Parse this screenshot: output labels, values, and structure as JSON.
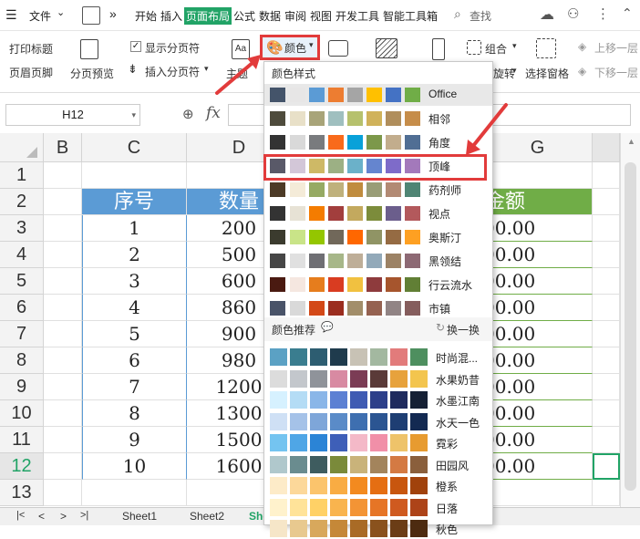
{
  "menubar": {
    "file_label": "文件",
    "more_label": "»",
    "tabs": [
      "开始",
      "插入",
      "页面布局",
      "公式",
      "数据",
      "审阅",
      "视图",
      "开发工具",
      "智能工具箱"
    ],
    "active_tab": "页面布局",
    "search_label": "查找"
  },
  "ribbon": {
    "print_titles": "打印标题",
    "header_footer": "页眉页脚",
    "page_break_preview": "分页预览",
    "show_page_breaks": "显示分页符",
    "insert_page_break": "插入分页符",
    "theme_label": "主题",
    "color_label": "颜色",
    "group_label": "组合",
    "rotate_label": "旋转",
    "selection_pane": "选择窗格",
    "bring_forward": "上移一层",
    "send_backward": "下移一层"
  },
  "formula_bar": {
    "name_box": "H12",
    "fx": "fx"
  },
  "grid": {
    "columns": [
      "B",
      "C",
      "D",
      "G"
    ],
    "rows": [
      "1",
      "2",
      "3",
      "4",
      "5",
      "6",
      "7",
      "8",
      "9",
      "10",
      "11",
      "12",
      "13"
    ],
    "header_seq": "序号",
    "header_qty": "数量",
    "header_amount": "金额",
    "seq": [
      "1",
      "2",
      "3",
      "4",
      "5",
      "6",
      "7",
      "8",
      "9",
      "10"
    ],
    "qty": [
      "200",
      "500",
      "600",
      "860",
      "900",
      "980",
      "1200",
      "1300",
      "1500",
      "1600"
    ],
    "amount": [
      "00.00",
      "00.00",
      "00.00",
      "00.00",
      "00.00",
      "00.00",
      "00.00",
      "00.00",
      "00.00",
      "00.00"
    ]
  },
  "sheets": {
    "tabs": [
      "Sheet1",
      "Sheet2",
      "She"
    ]
  },
  "dropdown": {
    "styles_title": "颜色样式",
    "recommend_title": "颜色推荐",
    "refresh_label": "换一换",
    "schemes": [
      {
        "name": "Office",
        "colors": [
          "#44546a",
          "#e7e6e6",
          "#5b9bd5",
          "#ed7d31",
          "#a5a5a5",
          "#ffc000",
          "#4472c4",
          "#70ad47"
        ]
      },
      {
        "name": "相邻",
        "colors": [
          "#4e4b3c",
          "#e8e0c8",
          "#a8a479",
          "#9fbfbf",
          "#b6c16d",
          "#d0b25a",
          "#b08e5c",
          "#c68d4a"
        ]
      },
      {
        "name": "角度",
        "colors": [
          "#333333",
          "#d9d9d9",
          "#797b7e",
          "#f96a1b",
          "#08a1d9",
          "#7c984a",
          "#c2ad8d",
          "#506e94"
        ]
      },
      {
        "name": "顶峰",
        "colors": [
          "#595968",
          "#d3c7d8",
          "#ceb966",
          "#9cb084",
          "#6bb1c9",
          "#6585cf",
          "#7e6bc9",
          "#a379bb"
        ]
      },
      {
        "name": "药剂师",
        "colors": [
          "#4c3a26",
          "#f4ebd8",
          "#96aa63",
          "#bfb17c",
          "#c08c3e",
          "#999d77",
          "#b28a74",
          "#4f8574"
        ]
      },
      {
        "name": "视点",
        "colors": [
          "#333333",
          "#e7e2d5",
          "#f47c00",
          "#a23e3d",
          "#c3a95e",
          "#7c8c3b",
          "#6b5e8c",
          "#b3595c"
        ]
      },
      {
        "name": "奥斯汀",
        "colors": [
          "#3b3b2e",
          "#c9e488",
          "#94c600",
          "#71685a",
          "#ff6700",
          "#909465",
          "#956b43",
          "#fea022"
        ]
      },
      {
        "name": "黑领结",
        "colors": [
          "#464646",
          "#e0e0e0",
          "#6f6f74",
          "#a7b789",
          "#beae98",
          "#92a9b9",
          "#9c8265",
          "#8d6974"
        ]
      },
      {
        "name": "行云流水",
        "colors": [
          "#4a1a11",
          "#f5e7e0",
          "#e67d1d",
          "#d93c21",
          "#f1c140",
          "#8e3b3d",
          "#a6552d",
          "#617f35"
        ]
      },
      {
        "name": "市镇",
        "colors": [
          "#495368",
          "#d9d9d9",
          "#d34817",
          "#9b2d1f",
          "#a28e6a",
          "#956251",
          "#918485",
          "#855d5d"
        ]
      }
    ],
    "recommends": [
      {
        "name": "时尚混...",
        "colors": [
          "#5ba1c4",
          "#3a7d8f",
          "#2d5d71",
          "#1f3b4d",
          "#c8c2b5",
          "#a3b8a0",
          "#e27b7b",
          "#4e8f5f"
        ]
      },
      {
        "name": "水果奶昔",
        "colors": [
          "#dcdcdc",
          "#c3c7cc",
          "#8f939a",
          "#d88aa2",
          "#7b3c55",
          "#5a3a38",
          "#e7a23c",
          "#f3c54e"
        ]
      },
      {
        "name": "水墨江南",
        "colors": [
          "#d6f1ff",
          "#b4dcf5",
          "#8ab6e8",
          "#5c80d3",
          "#3f5bb3",
          "#2d3f8a",
          "#1f2b5e",
          "#152034"
        ]
      },
      {
        "name": "水天一色",
        "colors": [
          "#cfe0f5",
          "#a5c2e8",
          "#7ea6d9",
          "#5a8bc8",
          "#3e6fb0",
          "#2b5592",
          "#1e3e73",
          "#132a52"
        ]
      },
      {
        "name": "霓彩",
        "colors": [
          "#74c4f0",
          "#4fa6e6",
          "#2b84d6",
          "#3e5fb8",
          "#f4b9c8",
          "#f18fa8",
          "#eec36a",
          "#e79b30"
        ]
      },
      {
        "name": "田园风",
        "colors": [
          "#b0c8cc",
          "#6a8c8f",
          "#3e5c5f",
          "#7a8a3a",
          "#c9b37a",
          "#a3845c",
          "#d47a43",
          "#8a5f3c"
        ]
      },
      {
        "name": "橙系",
        "colors": [
          "#fdebc8",
          "#fcd89a",
          "#fbc46c",
          "#f9ac43",
          "#f38a1f",
          "#e56e12",
          "#c8560e",
          "#a1420c"
        ]
      },
      {
        "name": "日落",
        "colors": [
          "#fff2cc",
          "#ffe399",
          "#ffd166",
          "#f9b44e",
          "#f39435",
          "#e67526",
          "#cf5a1f",
          "#ad4318"
        ]
      },
      {
        "name": "秋色",
        "colors": [
          "#f6e6c8",
          "#e8c98f",
          "#d8a85c",
          "#c58838",
          "#a96b26",
          "#8a521d",
          "#6b3d16",
          "#4d2b10"
        ]
      }
    ]
  }
}
